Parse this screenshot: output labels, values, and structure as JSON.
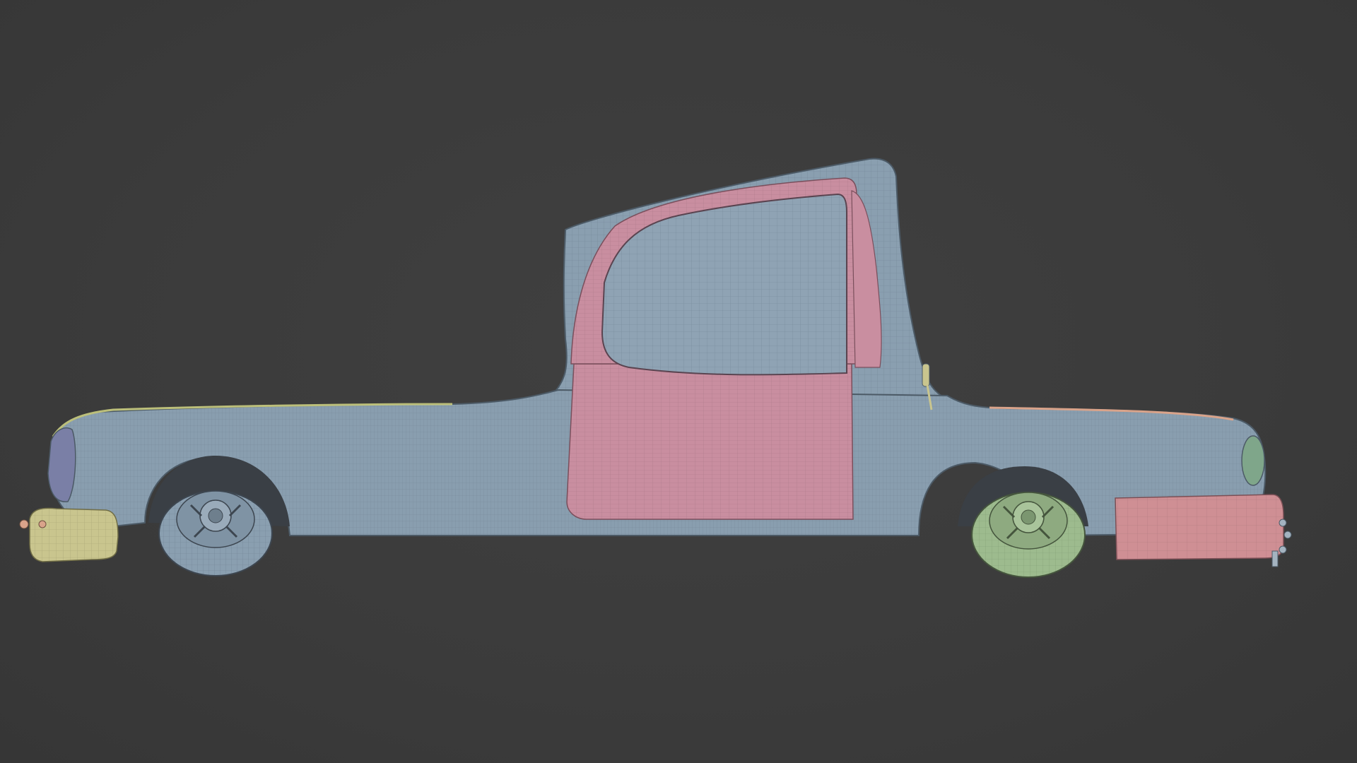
{
  "viewport": {
    "background": "#3c3c3c",
    "shading": "wireframe-overlay-solid"
  },
  "materials": {
    "body": "#8a9fb0",
    "body_wire": "#5f7180",
    "door": "#c98ea0",
    "door_wire": "#9a6a7a",
    "front_bumper": "#c9c58e",
    "front_bumper_wire": "#8f8c5f",
    "rear_bumper": "#cf8f94",
    "rear_wheel": "#9dbb8e",
    "rear_wheel_wire": "#6f8a62",
    "front_wheel": "#8a9fb0",
    "trim_yellow": "#bcbf7a",
    "trim_orange": "#d9a38a",
    "headlight": "#7a7fa6",
    "taillight": "#7fa68a"
  },
  "objects": [
    {
      "name": "car-body",
      "icon": "mesh-icon"
    },
    {
      "name": "door",
      "icon": "mesh-icon"
    },
    {
      "name": "front-wheel",
      "icon": "mesh-icon"
    },
    {
      "name": "rear-wheel",
      "icon": "mesh-icon"
    },
    {
      "name": "front-bumper",
      "icon": "mesh-icon"
    },
    {
      "name": "rear-bumper",
      "icon": "mesh-icon"
    }
  ]
}
